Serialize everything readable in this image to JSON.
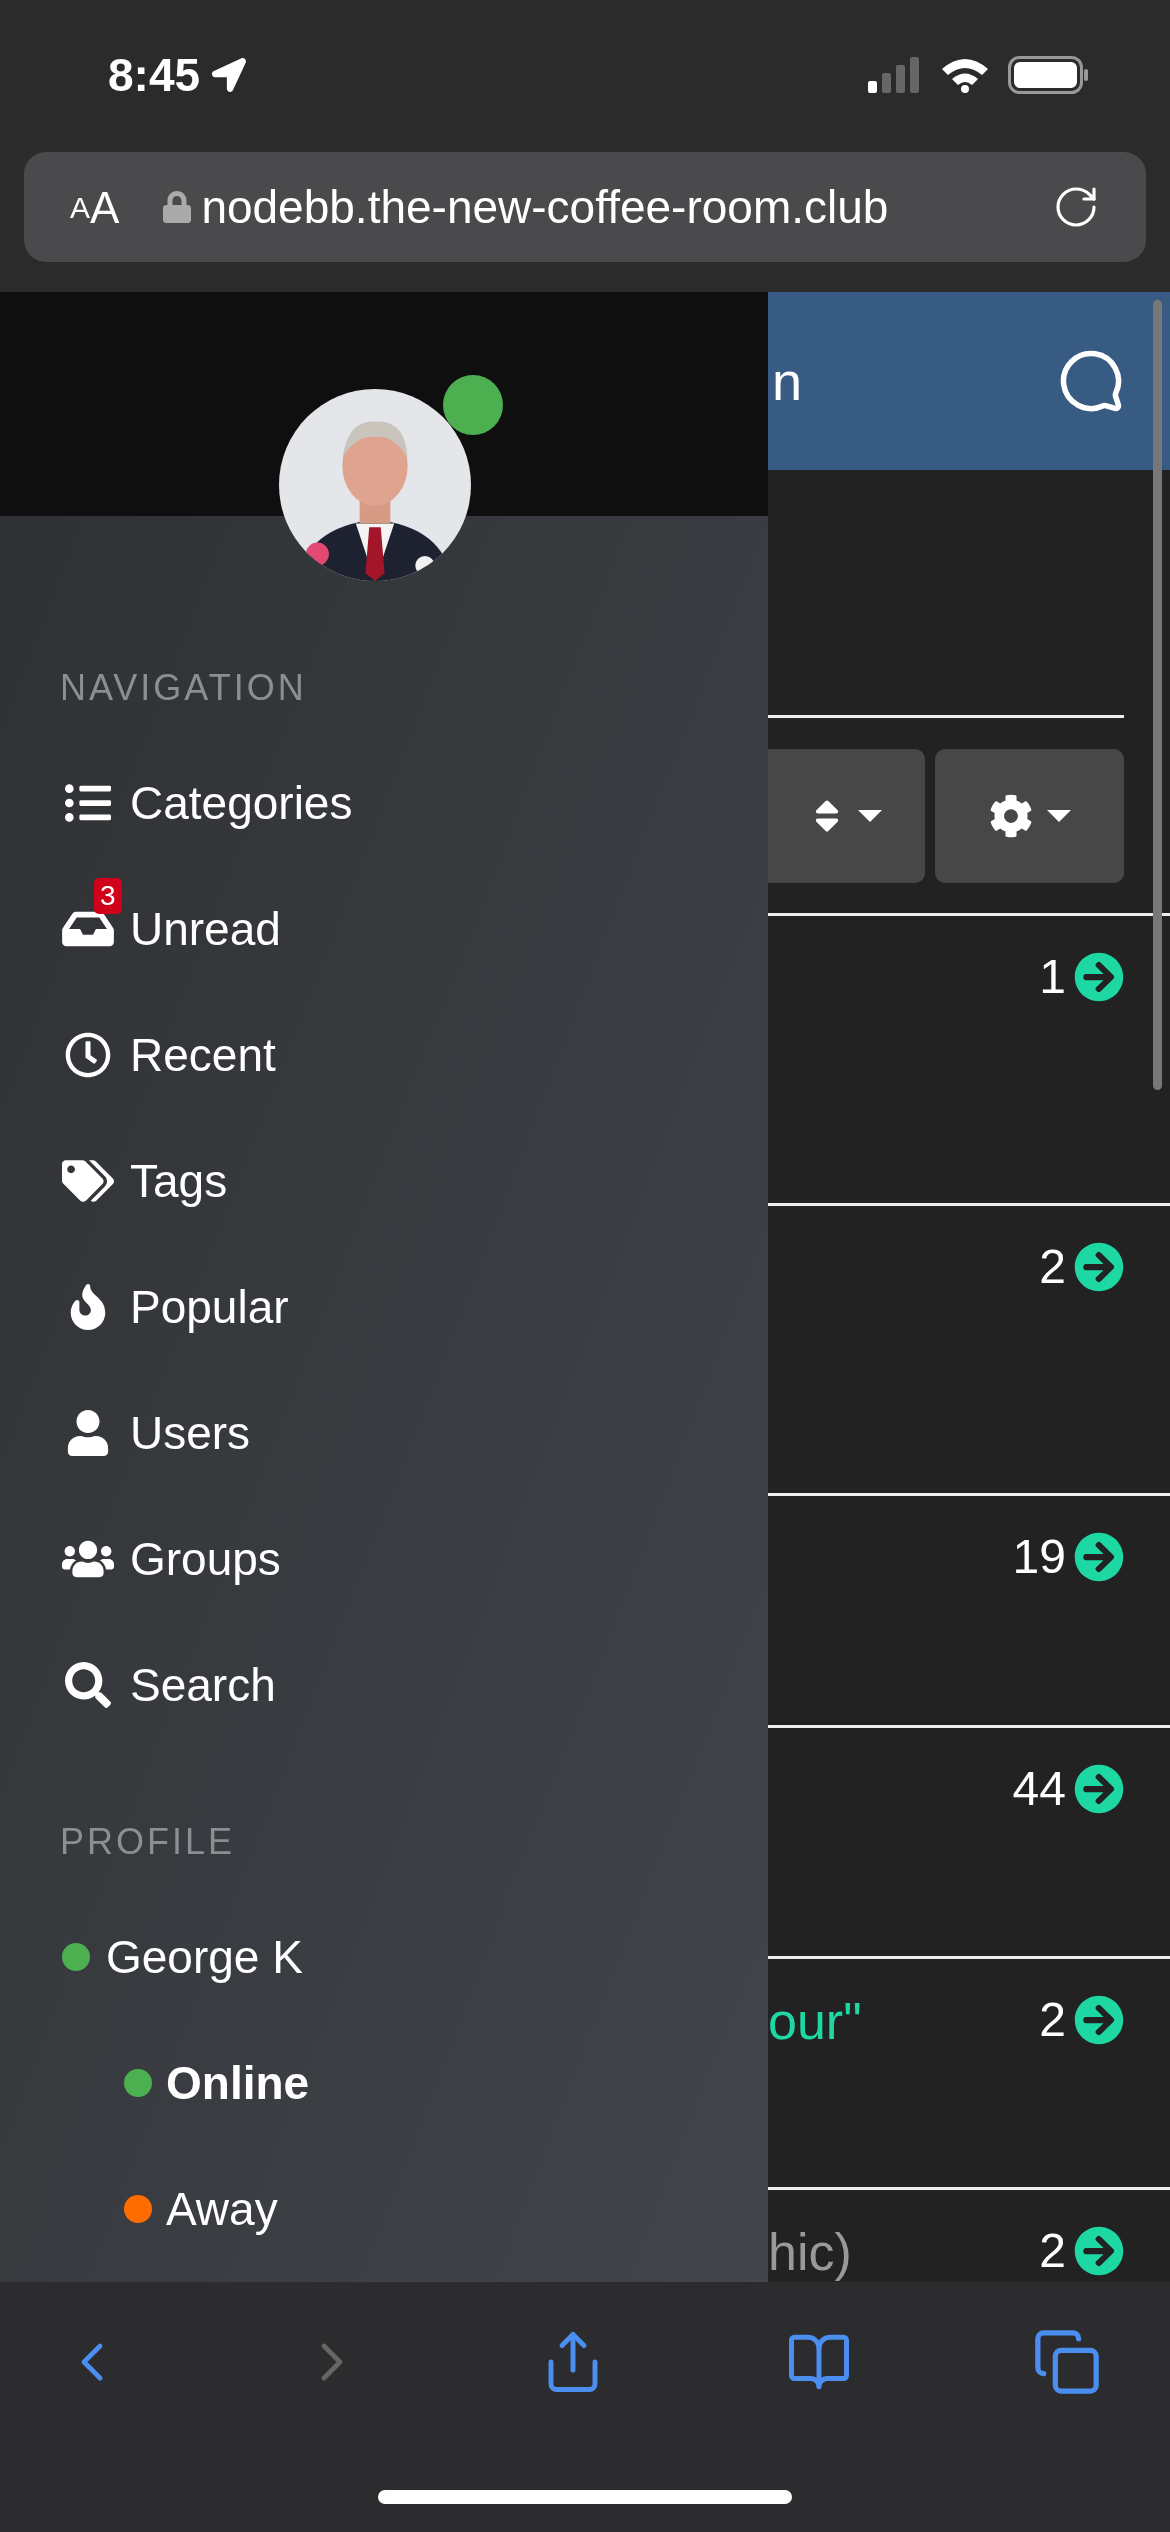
{
  "status_bar": {
    "time": "8:45"
  },
  "address_bar": {
    "text_size": [
      "A",
      "A"
    ],
    "url": "nodebb.the-new-coffee-room.club"
  },
  "drawer": {
    "user_online": true,
    "navigation_heading": "NAVIGATION",
    "navigation": [
      {
        "label": "Categories"
      },
      {
        "label": "Unread",
        "badge": "3"
      },
      {
        "label": "Recent"
      },
      {
        "label": "Tags"
      },
      {
        "label": "Popular"
      },
      {
        "label": "Users"
      },
      {
        "label": "Groups"
      },
      {
        "label": "Search"
      }
    ],
    "profile_heading": "PROFILE",
    "profile": {
      "name": "George K",
      "color": "#4caf50",
      "children": [
        {
          "label": "Online",
          "color": "#4caf50",
          "selected": true
        },
        {
          "label": "Away",
          "color": "#ff6d00",
          "selected": false
        }
      ]
    }
  },
  "page": {
    "header_title": "n",
    "topics": [
      {
        "count": "1"
      },
      {
        "count": "2"
      },
      {
        "count": "19"
      },
      {
        "count": "44"
      },
      {
        "title": "our\"",
        "read": false,
        "count": "2"
      },
      {
        "title": "hic)",
        "read": true,
        "count": "2"
      }
    ]
  },
  "toolbar": {
    "back": {
      "disabled": false
    },
    "forward": {
      "disabled": true
    }
  }
}
